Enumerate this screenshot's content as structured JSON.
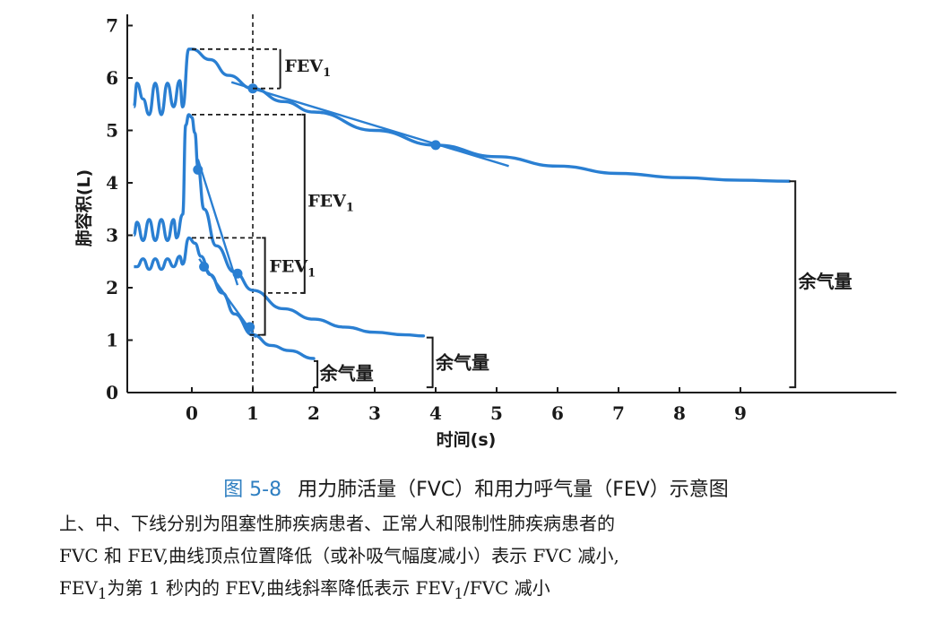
{
  "chart_data": {
    "type": "line",
    "xlabel": "时间(s)",
    "ylabel": "肺容积(L)",
    "xlim": [
      -1,
      10
    ],
    "ylim": [
      0,
      7.3
    ],
    "x_ticks": [
      0,
      1,
      2,
      3,
      4,
      5,
      6,
      7,
      8,
      9
    ],
    "y_ticks": [
      0,
      1,
      2,
      3,
      4,
      5,
      6,
      7
    ],
    "grid": false,
    "colors": {
      "line": "#2a7fd2",
      "text": "#1a1a1a"
    },
    "vertical_reference": {
      "x": 1,
      "style": "dashed"
    },
    "series": [
      {
        "key": "upper",
        "tidal": {
          "x": [
            -0.95,
            -0.9,
            -0.8,
            -0.7,
            -0.6,
            -0.5,
            -0.4,
            -0.3,
            -0.2,
            -0.15
          ],
          "y": [
            5.45,
            5.9,
            5.6,
            5.3,
            5.9,
            5.3,
            5.9,
            5.45,
            5.95,
            5.45
          ]
        },
        "points": [
          [
            -0.15,
            5.45
          ],
          [
            -0.05,
            6.55
          ],
          [
            0.0,
            6.55
          ],
          [
            0.3,
            6.35
          ],
          [
            0.6,
            6.05
          ],
          [
            1.0,
            5.8
          ],
          [
            1.5,
            5.55
          ],
          [
            2.0,
            5.35
          ],
          [
            3.0,
            5.0
          ],
          [
            4.0,
            4.72
          ],
          [
            5.0,
            4.5
          ],
          [
            6.0,
            4.32
          ],
          [
            7.0,
            4.18
          ],
          [
            8.0,
            4.1
          ],
          [
            9.0,
            4.05
          ],
          [
            9.8,
            4.03
          ]
        ],
        "markers": [
          [
            1.0,
            5.8
          ],
          [
            4.0,
            4.72
          ]
        ],
        "tangent": [
          [
            0.65,
            5.92
          ],
          [
            5.2,
            4.32
          ]
        ]
      },
      {
        "key": "middle",
        "tidal": {
          "x": [
            -0.95,
            -0.9,
            -0.8,
            -0.7,
            -0.6,
            -0.5,
            -0.4,
            -0.3,
            -0.25
          ],
          "y": [
            3.0,
            3.25,
            2.9,
            3.3,
            2.9,
            3.3,
            2.9,
            3.3,
            2.95
          ]
        },
        "points": [
          [
            -0.25,
            2.95
          ],
          [
            -0.15,
            3.4
          ],
          [
            -0.1,
            5.1
          ],
          [
            -0.05,
            5.3
          ],
          [
            0.0,
            5.25
          ],
          [
            0.05,
            4.95
          ],
          [
            0.1,
            4.3
          ],
          [
            0.2,
            3.5
          ],
          [
            0.4,
            2.8
          ],
          [
            0.7,
            2.3
          ],
          [
            1.0,
            1.95
          ],
          [
            1.5,
            1.6
          ],
          [
            2.0,
            1.4
          ],
          [
            2.5,
            1.25
          ],
          [
            3.0,
            1.15
          ],
          [
            3.5,
            1.1
          ],
          [
            3.8,
            1.08
          ]
        ],
        "markers": [
          [
            0.1,
            4.25
          ],
          [
            0.75,
            2.27
          ]
        ],
        "tangent": [
          [
            0.1,
            4.45
          ],
          [
            0.75,
            2.05
          ]
        ]
      },
      {
        "key": "lower",
        "tidal": {
          "x": [
            -0.95,
            -0.9,
            -0.8,
            -0.7,
            -0.6,
            -0.5,
            -0.4,
            -0.3,
            -0.2,
            -0.15
          ],
          "y": [
            2.4,
            2.4,
            2.55,
            2.35,
            2.55,
            2.35,
            2.55,
            2.4,
            2.6,
            2.45
          ]
        },
        "points": [
          [
            -0.15,
            2.45
          ],
          [
            -0.05,
            2.95
          ],
          [
            0.05,
            2.85
          ],
          [
            0.15,
            2.6
          ],
          [
            0.3,
            2.25
          ],
          [
            0.5,
            1.9
          ],
          [
            0.7,
            1.5
          ],
          [
            1.0,
            1.1
          ],
          [
            1.3,
            0.9
          ],
          [
            1.6,
            0.8
          ],
          [
            2.0,
            0.65
          ]
        ],
        "markers": [
          [
            0.2,
            2.4
          ],
          [
            0.95,
            1.25
          ]
        ],
        "tangent": [
          [
            0.12,
            2.55
          ],
          [
            1.05,
            1.05
          ]
        ]
      }
    ],
    "annotations": [
      {
        "key": "fev1_upper",
        "text": "FEV",
        "sub": "1"
      },
      {
        "key": "fev1_middle",
        "text": "FEV",
        "sub": "1"
      },
      {
        "key": "fev1_lower",
        "text": "FEV",
        "sub": "1"
      },
      {
        "key": "rv_upper",
        "text": "余气量"
      },
      {
        "key": "rv_middle",
        "text": "余气量"
      },
      {
        "key": "rv_lower",
        "text": "余气量"
      }
    ]
  },
  "caption": {
    "figure_number": "图 5-8",
    "title": "用力肺活量（FVC）和用力呼气量（FEV）示意图",
    "line1": "上、中、下线分别为阻塞性肺疾病患者、正常人和限制性肺疾病患者的",
    "line2": "FVC 和 FEV,曲线顶点位置降低（或补吸气幅度减小）表示 FVC 减小,",
    "line3_a": "FEV",
    "line3_sub": "1",
    "line3_b": "为第 1 秒内的 FEV,曲线斜率降低表示 FEV",
    "line3_sub2": "1",
    "line3_c": "/FVC 减小"
  }
}
